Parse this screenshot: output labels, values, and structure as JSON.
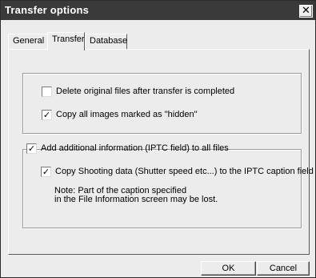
{
  "window": {
    "title": "Transfer options",
    "close_glyph": "✕"
  },
  "tabs": [
    {
      "label": "General",
      "active": false
    },
    {
      "label": "Transfer",
      "active": true
    },
    {
      "label": "Database",
      "active": false
    }
  ],
  "transfer": {
    "delete_original": {
      "label": "Delete original files after transfer is completed",
      "checked": false
    },
    "copy_hidden": {
      "label": "Copy all images marked as \"hidden\"",
      "checked": true
    },
    "add_iptc": {
      "label": "Add additional information (IPTC field) to all files",
      "checked": true
    },
    "copy_shooting": {
      "label": "Copy Shooting data (Shutter speed etc...) to the IPTC caption field",
      "checked": true
    },
    "note_lines": [
      "Note: Part of the caption specified",
      "in the File Information screen may be lost."
    ]
  },
  "buttons": {
    "ok_label": "OK",
    "cancel_label": "Cancel"
  },
  "check_glyph": "✓"
}
